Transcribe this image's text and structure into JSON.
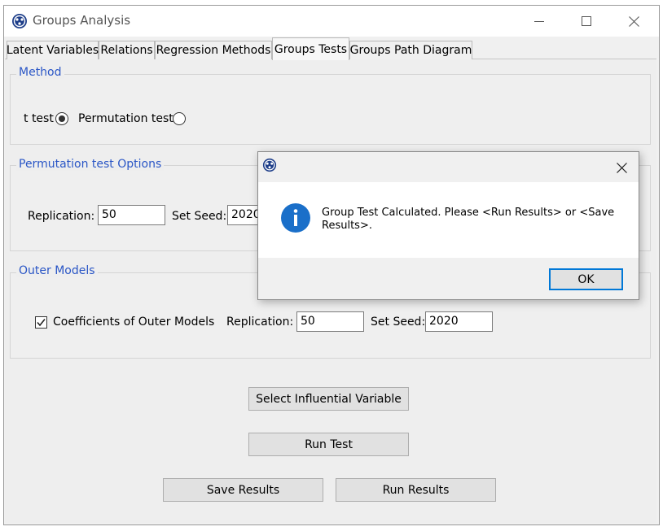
{
  "window": {
    "title": "Groups Analysis"
  },
  "tabs": [
    {
      "label": "Latent Variables"
    },
    {
      "label": "Relations"
    },
    {
      "label": "Regression Methods"
    },
    {
      "label": "Groups Tests"
    },
    {
      "label": "Groups Path Diagram"
    }
  ],
  "active_tab": "Groups Tests",
  "method": {
    "title": "Method",
    "t_test_label": "t test",
    "t_test_selected": true,
    "permutation_label": "Permutation test",
    "permutation_selected": false
  },
  "permutation_options": {
    "title": "Permutation test Options",
    "replication_label": "Replication:",
    "replication_value": "50",
    "seed_label": "Set Seed:",
    "seed_value": "2020"
  },
  "outer_models": {
    "title": "Outer Models",
    "coefficients_label": "Coefficients of Outer Models",
    "coefficients_checked": true,
    "replication_label": "Replication:",
    "replication_value": "50",
    "seed_label": "Set Seed:",
    "seed_value": "2020"
  },
  "buttons": {
    "select_influential": "Select Influential Variable",
    "run_test": "Run Test",
    "save_results": "Save Results",
    "run_results": "Run Results"
  },
  "dialog": {
    "icon": "info-icon",
    "message_line1": "Group Test Calculated. Please <Run Results> or <Save",
    "message_line2": "Results>.",
    "ok_label": "OK"
  },
  "colors": {
    "group_title": "#2a56c6",
    "info_icon": "#1a6fc9",
    "dialog_default_border": "#0078d7"
  }
}
